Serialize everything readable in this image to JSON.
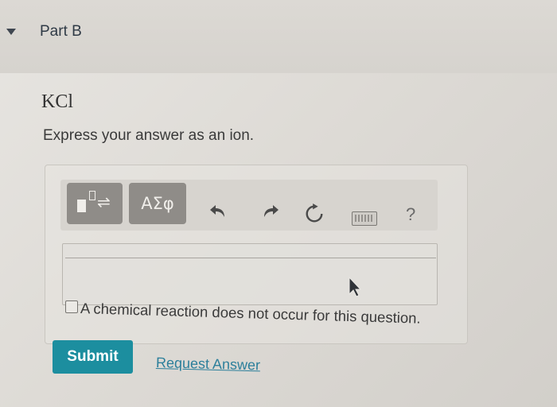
{
  "part": {
    "title": "Part B",
    "expand_icon": "caret-down-icon"
  },
  "question": {
    "compound": "KCl",
    "instruction": "Express your answer as an ion."
  },
  "toolbar": {
    "templates_icon": "templates-icon",
    "symbols_label": "ΑΣφ",
    "undo_icon": "undo-icon",
    "redo_icon": "redo-icon",
    "reset_icon": "reset-icon",
    "keyboard_icon": "keyboard-icon",
    "help_label": "?"
  },
  "answer": {
    "value": "",
    "no_reaction_label": "A chemical reaction does not occur for this question.",
    "no_reaction_checked": false
  },
  "actions": {
    "submit_label": "Submit",
    "request_answer_label": "Request Answer"
  },
  "colors": {
    "submit": "#1c8e9f",
    "link": "#2c7f9b",
    "toolbar_button": "#8f8c88"
  }
}
